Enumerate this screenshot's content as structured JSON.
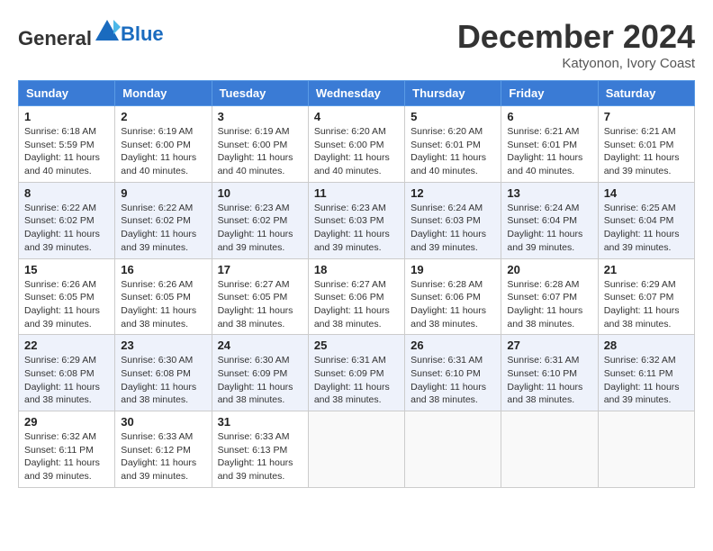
{
  "header": {
    "logo_general": "General",
    "logo_blue": "Blue",
    "month_year": "December 2024",
    "location": "Katyonon, Ivory Coast"
  },
  "calendar": {
    "days_of_week": [
      "Sunday",
      "Monday",
      "Tuesday",
      "Wednesday",
      "Thursday",
      "Friday",
      "Saturday"
    ],
    "weeks": [
      [
        {
          "day": "1",
          "sunrise": "6:18 AM",
          "sunset": "5:59 PM",
          "daylight": "11 hours and 40 minutes."
        },
        {
          "day": "2",
          "sunrise": "6:19 AM",
          "sunset": "6:00 PM",
          "daylight": "11 hours and 40 minutes."
        },
        {
          "day": "3",
          "sunrise": "6:19 AM",
          "sunset": "6:00 PM",
          "daylight": "11 hours and 40 minutes."
        },
        {
          "day": "4",
          "sunrise": "6:20 AM",
          "sunset": "6:00 PM",
          "daylight": "11 hours and 40 minutes."
        },
        {
          "day": "5",
          "sunrise": "6:20 AM",
          "sunset": "6:01 PM",
          "daylight": "11 hours and 40 minutes."
        },
        {
          "day": "6",
          "sunrise": "6:21 AM",
          "sunset": "6:01 PM",
          "daylight": "11 hours and 40 minutes."
        },
        {
          "day": "7",
          "sunrise": "6:21 AM",
          "sunset": "6:01 PM",
          "daylight": "11 hours and 39 minutes."
        }
      ],
      [
        {
          "day": "8",
          "sunrise": "6:22 AM",
          "sunset": "6:02 PM",
          "daylight": "11 hours and 39 minutes."
        },
        {
          "day": "9",
          "sunrise": "6:22 AM",
          "sunset": "6:02 PM",
          "daylight": "11 hours and 39 minutes."
        },
        {
          "day": "10",
          "sunrise": "6:23 AM",
          "sunset": "6:02 PM",
          "daylight": "11 hours and 39 minutes."
        },
        {
          "day": "11",
          "sunrise": "6:23 AM",
          "sunset": "6:03 PM",
          "daylight": "11 hours and 39 minutes."
        },
        {
          "day": "12",
          "sunrise": "6:24 AM",
          "sunset": "6:03 PM",
          "daylight": "11 hours and 39 minutes."
        },
        {
          "day": "13",
          "sunrise": "6:24 AM",
          "sunset": "6:04 PM",
          "daylight": "11 hours and 39 minutes."
        },
        {
          "day": "14",
          "sunrise": "6:25 AM",
          "sunset": "6:04 PM",
          "daylight": "11 hours and 39 minutes."
        }
      ],
      [
        {
          "day": "15",
          "sunrise": "6:26 AM",
          "sunset": "6:05 PM",
          "daylight": "11 hours and 39 minutes."
        },
        {
          "day": "16",
          "sunrise": "6:26 AM",
          "sunset": "6:05 PM",
          "daylight": "11 hours and 38 minutes."
        },
        {
          "day": "17",
          "sunrise": "6:27 AM",
          "sunset": "6:05 PM",
          "daylight": "11 hours and 38 minutes."
        },
        {
          "day": "18",
          "sunrise": "6:27 AM",
          "sunset": "6:06 PM",
          "daylight": "11 hours and 38 minutes."
        },
        {
          "day": "19",
          "sunrise": "6:28 AM",
          "sunset": "6:06 PM",
          "daylight": "11 hours and 38 minutes."
        },
        {
          "day": "20",
          "sunrise": "6:28 AM",
          "sunset": "6:07 PM",
          "daylight": "11 hours and 38 minutes."
        },
        {
          "day": "21",
          "sunrise": "6:29 AM",
          "sunset": "6:07 PM",
          "daylight": "11 hours and 38 minutes."
        }
      ],
      [
        {
          "day": "22",
          "sunrise": "6:29 AM",
          "sunset": "6:08 PM",
          "daylight": "11 hours and 38 minutes."
        },
        {
          "day": "23",
          "sunrise": "6:30 AM",
          "sunset": "6:08 PM",
          "daylight": "11 hours and 38 minutes."
        },
        {
          "day": "24",
          "sunrise": "6:30 AM",
          "sunset": "6:09 PM",
          "daylight": "11 hours and 38 minutes."
        },
        {
          "day": "25",
          "sunrise": "6:31 AM",
          "sunset": "6:09 PM",
          "daylight": "11 hours and 38 minutes."
        },
        {
          "day": "26",
          "sunrise": "6:31 AM",
          "sunset": "6:10 PM",
          "daylight": "11 hours and 38 minutes."
        },
        {
          "day": "27",
          "sunrise": "6:31 AM",
          "sunset": "6:10 PM",
          "daylight": "11 hours and 38 minutes."
        },
        {
          "day": "28",
          "sunrise": "6:32 AM",
          "sunset": "6:11 PM",
          "daylight": "11 hours and 39 minutes."
        }
      ],
      [
        {
          "day": "29",
          "sunrise": "6:32 AM",
          "sunset": "6:11 PM",
          "daylight": "11 hours and 39 minutes."
        },
        {
          "day": "30",
          "sunrise": "6:33 AM",
          "sunset": "6:12 PM",
          "daylight": "11 hours and 39 minutes."
        },
        {
          "day": "31",
          "sunrise": "6:33 AM",
          "sunset": "6:13 PM",
          "daylight": "11 hours and 39 minutes."
        },
        null,
        null,
        null,
        null
      ]
    ]
  }
}
